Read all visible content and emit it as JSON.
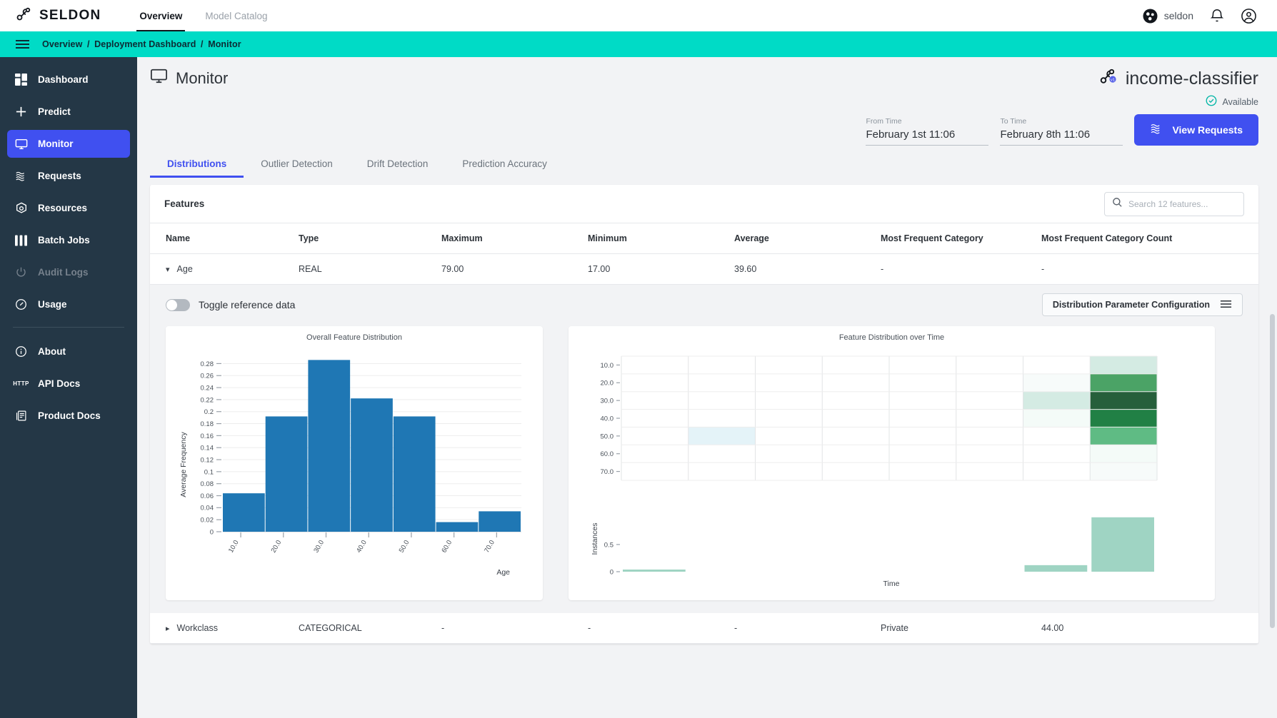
{
  "topbar": {
    "brand": "SELDON",
    "brand_icon": "seldon-logo-icon",
    "nav": [
      {
        "label": "Overview",
        "active": true
      },
      {
        "label": "Model Catalog",
        "active": false
      }
    ],
    "org": "seldon",
    "org_icon": "org-dot-icon",
    "bell_icon": "notification-bell-icon",
    "account_icon": "account-circle-icon"
  },
  "breadcrumb": {
    "menu_icon": "hamburger-menu-icon",
    "items": [
      "Overview",
      "Deployment Dashboard",
      "Monitor"
    ],
    "separator": "/",
    "bg": "#00dbc6"
  },
  "sidebar": {
    "items": [
      {
        "label": "Dashboard",
        "icon": "dashboard-grid-icon",
        "state": "normal"
      },
      {
        "label": "Predict",
        "icon": "plus-icon",
        "state": "normal"
      },
      {
        "label": "Monitor",
        "icon": "monitor-screen-icon",
        "state": "active"
      },
      {
        "label": "Requests",
        "icon": "waves-icon",
        "state": "normal"
      },
      {
        "label": "Resources",
        "icon": "kubernetes-icon",
        "state": "normal"
      },
      {
        "label": "Batch Jobs",
        "icon": "bars-icon",
        "state": "normal"
      },
      {
        "label": "Audit Logs",
        "icon": "power-icon",
        "state": "disabled"
      },
      {
        "label": "Usage",
        "icon": "gauge-icon",
        "state": "normal"
      }
    ],
    "footer_items": [
      {
        "label": "About",
        "icon": "info-circle-icon"
      },
      {
        "label": "API Docs",
        "icon": "http-badge-icon"
      },
      {
        "label": "Product Docs",
        "icon": "docs-icon"
      }
    ],
    "accent": "#4050f0",
    "bg": "#243746"
  },
  "page": {
    "title": "Monitor",
    "title_icon": "monitor-screen-icon",
    "deployment_name": "income-classifier",
    "deployment_icon": "deployment-node-icon",
    "status": "Available",
    "status_icon": "check-circle-icon"
  },
  "filters": {
    "from": {
      "label": "From Time",
      "value": "February 1st 11:06"
    },
    "to": {
      "label": "To Time",
      "value": "February 8th 11:06"
    },
    "view_requests": {
      "label": "View Requests",
      "icon": "waves-icon"
    }
  },
  "tabs": [
    {
      "label": "Distributions",
      "active": true
    },
    {
      "label": "Outlier Detection",
      "active": false
    },
    {
      "label": "Drift Detection",
      "active": false
    },
    {
      "label": "Prediction Accuracy",
      "active": false
    }
  ],
  "features_panel": {
    "title": "Features",
    "search": {
      "placeholder": "Search 12 features...",
      "value": "",
      "icon": "search-icon"
    },
    "columns": [
      "Name",
      "Type",
      "Maximum",
      "Minimum",
      "Average",
      "Most Frequent Category",
      "Most Frequent Category Count"
    ],
    "rows": [
      {
        "name": "Age",
        "type": "REAL",
        "maximum": "79.00",
        "minimum": "17.00",
        "average": "39.60",
        "most_frequent_category": "-",
        "most_frequent_category_count": "-",
        "expanded": true,
        "chevron": "chevron-down-icon"
      },
      {
        "name": "Workclass",
        "type": "CATEGORICAL",
        "maximum": "-",
        "minimum": "-",
        "average": "-",
        "most_frequent_category": "Private",
        "most_frequent_category_count": "44.00",
        "expanded": false,
        "chevron": "chevron-right-icon"
      }
    ]
  },
  "expanded": {
    "toggle_label": "Toggle reference data",
    "toggle_on": false,
    "config_button": {
      "label": "Distribution Parameter Configuration",
      "icon": "menu-lines-icon"
    }
  },
  "chart_data": [
    {
      "type": "bar",
      "title": "Overall Feature Distribution",
      "xlabel": "Age",
      "ylabel": "Average Frequency",
      "categories": [
        "10.0",
        "20.0",
        "30.0",
        "40.0",
        "50.0",
        "60.0",
        "70.0"
      ],
      "values": [
        0.064,
        0.192,
        0.286,
        0.222,
        0.192,
        0.016,
        0.034
      ],
      "ytick_labels": [
        "0",
        "0.02",
        "0.04",
        "0.06",
        "0.08",
        "0.1",
        "0.12",
        "0.14",
        "0.16",
        "0.18",
        "0.2",
        "0.22",
        "0.24",
        "0.26",
        "0.28"
      ],
      "ylim": [
        0,
        0.29
      ],
      "grid": true,
      "bar_color": "#1f77b4",
      "legend": "none"
    },
    {
      "type": "heatmap",
      "title": "Feature Distribution over Time",
      "xlabel": "Time",
      "ylabel": "",
      "ytick_labels": [
        "10.0",
        "20.0",
        "30.0",
        "40.0",
        "50.0",
        "60.0",
        "70.0"
      ],
      "columns": 8,
      "rows": 7,
      "grid": true,
      "cells": [
        [
          "#ffffff",
          "#ffffff",
          "#ffffff",
          "#ffffff",
          "#ffffff",
          "#ffffff",
          "#ffffff",
          "#d4ebe3"
        ],
        [
          "#ffffff",
          "#ffffff",
          "#ffffff",
          "#ffffff",
          "#ffffff",
          "#ffffff",
          "#f7fbfa",
          "#4ba366"
        ],
        [
          "#ffffff",
          "#ffffff",
          "#ffffff",
          "#ffffff",
          "#ffffff",
          "#ffffff",
          "#d4ebe3",
          "#265f3b"
        ],
        [
          "#ffffff",
          "#ffffff",
          "#ffffff",
          "#ffffff",
          "#ffffff",
          "#ffffff",
          "#f4fbf8",
          "#218045"
        ],
        [
          "#ffffff",
          "#e4f3f8",
          "#ffffff",
          "#ffffff",
          "#ffffff",
          "#ffffff",
          "#ffffff",
          "#5fbb84"
        ],
        [
          "#ffffff",
          "#ffffff",
          "#ffffff",
          "#ffffff",
          "#ffffff",
          "#ffffff",
          "#ffffff",
          "#f4fbf8"
        ],
        [
          "#ffffff",
          "#ffffff",
          "#ffffff",
          "#ffffff",
          "#ffffff",
          "#ffffff",
          "#ffffff",
          "#f7fbfa"
        ]
      ]
    },
    {
      "type": "bar",
      "title": "",
      "xlabel": "Time",
      "ylabel": "Instances",
      "ytick_labels": [
        "0",
        "0.5"
      ],
      "ylim": [
        0,
        1.05
      ],
      "columns": 8,
      "values": [
        0.02,
        0,
        0,
        0,
        0,
        0,
        0.12,
        1.0
      ],
      "bar_color": "#9fd4c3",
      "grid": false
    }
  ]
}
